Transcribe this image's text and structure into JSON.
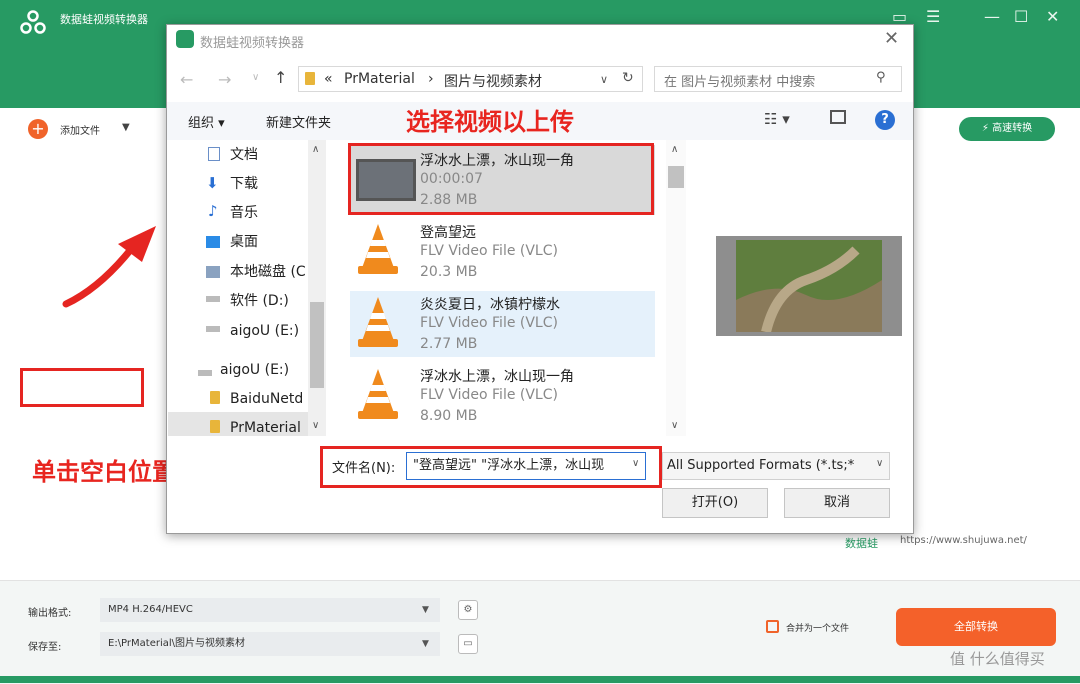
{
  "app": {
    "title": "数据蛙视频转换器",
    "add_file": "添加文件",
    "speed_convert": "高速转换",
    "watermark_brand": "数据蛙",
    "watermark_url": "https://www.shujuwa.net/",
    "output_format_label": "输出格式:",
    "output_format_value": "MP4 H.264/HEVC",
    "save_to_label": "保存至:",
    "save_to_value": "E:\\PrMaterial\\图片与视频素材",
    "merge_label": "合并为一个文件",
    "convert_all": "全部转换",
    "corner_watermark": "值 什么值得买",
    "accent_color": "#279a63",
    "action_color": "#f4612a"
  },
  "dialog": {
    "title": "数据蛙视频转换器",
    "address_prefix": "«",
    "address_folder": "PrMaterial",
    "address_sep": "›",
    "address_sub": "图片与视频素材",
    "search_placeholder": "在 图片与视频素材 中搜索",
    "organize": "组织 ▾",
    "new_folder": "新建文件夹",
    "sidebar": [
      {
        "label": "文档"
      },
      {
        "label": "下载"
      },
      {
        "label": "音乐"
      },
      {
        "label": "桌面"
      },
      {
        "label": "本地磁盘 (C"
      },
      {
        "label": "软件 (D:)"
      },
      {
        "label": "aigoU (E:)"
      },
      {
        "label": "aigoU (E:)"
      },
      {
        "label": "BaiduNetd"
      },
      {
        "label": "PrMaterial"
      }
    ],
    "files": [
      {
        "name": "浮冰水上漂，冰山现一角",
        "line2": "00:00:07",
        "line3": "2.88 MB"
      },
      {
        "name": "登高望远",
        "line2": "FLV Video File (VLC)",
        "line3": "20.3 MB"
      },
      {
        "name": "炎炎夏日，冰镇柠檬水",
        "line2": "FLV Video File (VLC)",
        "line3": "2.77 MB"
      },
      {
        "name": "浮冰水上漂，冰山现一角",
        "line2": "FLV Video File (VLC)",
        "line3": "8.90 MB"
      }
    ],
    "filename_label": "文件名(N):",
    "filename_value": "\"登高望远\" \"浮冰水上漂，冰山现",
    "format_value": "All Supported Formats (*.ts;*",
    "open_btn": "打开(O)",
    "cancel_btn": "取消"
  },
  "annotations": {
    "select_video": "选择视频以上传",
    "click_blank": "单击空白位置"
  }
}
